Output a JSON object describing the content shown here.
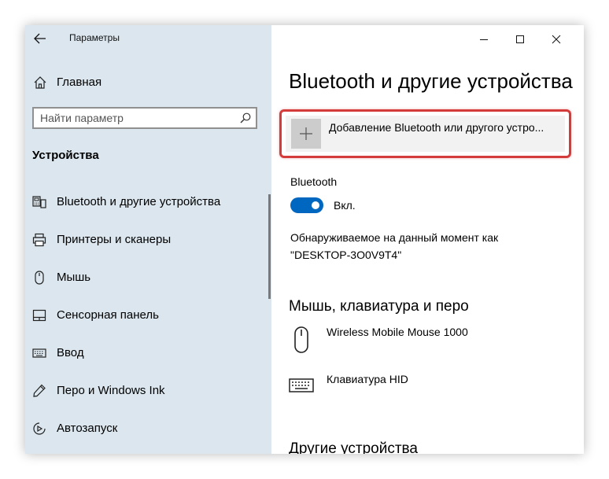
{
  "window": {
    "title": "Параметры"
  },
  "sidebar": {
    "home_label": "Главная",
    "search": {
      "placeholder": "Найти параметр"
    },
    "section_title": "Устройства",
    "items": [
      {
        "label": "Bluetooth и другие устройства",
        "icon": "bluetooth-devices-icon"
      },
      {
        "label": "Принтеры и сканеры",
        "icon": "printer-icon"
      },
      {
        "label": "Мышь",
        "icon": "mouse-icon"
      },
      {
        "label": "Сенсорная панель",
        "icon": "touchpad-icon"
      },
      {
        "label": "Ввод",
        "icon": "keyboard-icon"
      },
      {
        "label": "Перо и Windows Ink",
        "icon": "pen-icon"
      },
      {
        "label": "Автозапуск",
        "icon": "autoplay-icon"
      }
    ]
  },
  "main": {
    "title": "Bluetooth и другие устройства",
    "add_device_label": "Добавление Bluetooth или другого устро...",
    "bluetooth": {
      "label": "Bluetooth",
      "state_label": "Вкл.",
      "on": true
    },
    "discoverable_line1": "Обнаруживаемое на данный момент как",
    "discoverable_line2": "\"DESKTOP-3O0V9T4\"",
    "section_input": "Мышь, клавиатура и перо",
    "devices": [
      {
        "label": "Wireless Mobile Mouse 1000",
        "icon": "mouse-icon"
      },
      {
        "label": "Клавиатура HID",
        "icon": "keyboard-icon"
      }
    ],
    "section_other": "Другие устройства"
  },
  "colors": {
    "sidebar_bg": "#dbe6ee",
    "accent": "#0067c0",
    "highlight_outline": "#d43c3c"
  }
}
